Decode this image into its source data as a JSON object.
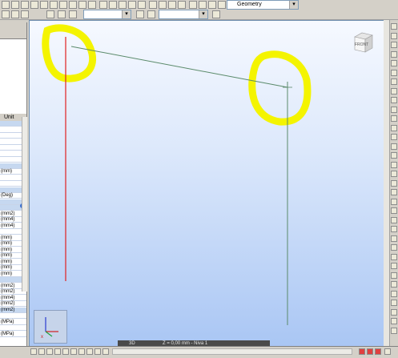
{
  "toolbar": {
    "geometry_combo": "Geometry",
    "combo2_value": "",
    "combo3_value": ""
  },
  "left_panel": {
    "header_unit": "Unit",
    "rows": [
      "",
      "",
      "",
      "",
      "",
      "",
      "",
      "",
      "(mm)",
      "",
      "",
      "",
      "(Deg)",
      "",
      "",
      "(mm2)",
      "(mm4)",
      "(mm4)",
      "",
      "(mm)",
      "(mm)",
      "(mm)",
      "(mm)",
      "(mm)",
      "(mm)",
      "(mm)",
      "",
      "(mm2)",
      "(mm2)",
      "(mm4)",
      "(mm2)",
      "(mm2)",
      "",
      "(MPa)",
      "",
      "(MPa)"
    ]
  },
  "viewport": {
    "view_cube_label": "FRONT",
    "status_mode": "3D",
    "status_text": "Z = 0,00 mm - Niva 1"
  },
  "colors": {
    "red_column": "#e02020",
    "green_member": "#5a8a6a",
    "highlight": "#f4f400"
  }
}
